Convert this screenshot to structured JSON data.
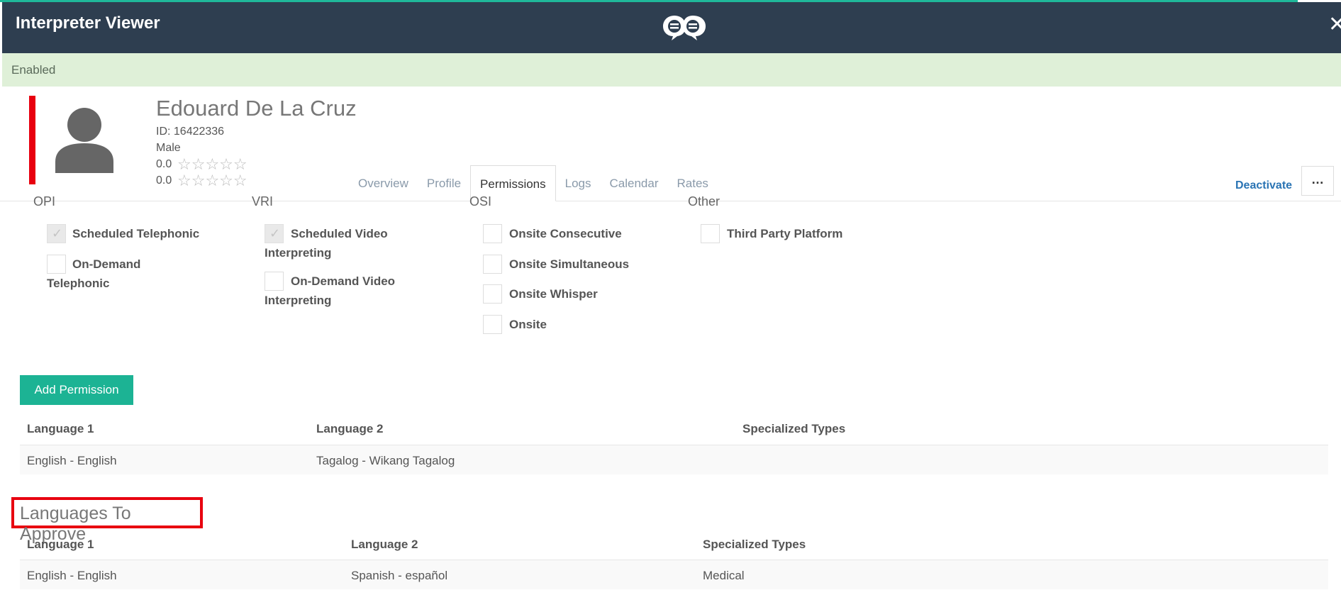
{
  "header": {
    "title": "Interpreter Viewer",
    "logo_icon": "chat-bubbles-logo",
    "close_icon": "close-icon",
    "close_glyph": "✕"
  },
  "status": {
    "label": "Enabled"
  },
  "profile": {
    "name": "Edouard De La Cruz",
    "id_label": "ID: 16422336",
    "gender": "Male",
    "rating1": "0.0",
    "rating2": "0.0",
    "stars": "☆☆☆☆☆"
  },
  "tabs": [
    {
      "label": "Overview",
      "active": false
    },
    {
      "label": "Profile",
      "active": false
    },
    {
      "label": "Permissions",
      "active": true
    },
    {
      "label": "Logs",
      "active": false
    },
    {
      "label": "Calendar",
      "active": false
    },
    {
      "label": "Rates",
      "active": false
    }
  ],
  "actions": {
    "deactivate": "Deactivate",
    "more": "…"
  },
  "categories": {
    "opi": {
      "heading": "OPI",
      "items": [
        {
          "label": "Scheduled Telephonic",
          "checked": true
        },
        {
          "label": "On-Demand Telephonic",
          "checked": false
        }
      ]
    },
    "vri": {
      "heading": "VRI",
      "items": [
        {
          "label": "Scheduled Video Interpreting",
          "checked": true
        },
        {
          "label": "On-Demand Video Interpreting",
          "checked": false
        }
      ]
    },
    "osi": {
      "heading": "OSI",
      "items": [
        {
          "label": "Onsite Consecutive",
          "checked": false
        },
        {
          "label": "Onsite Simultaneous",
          "checked": false
        },
        {
          "label": "Onsite Whisper",
          "checked": false
        },
        {
          "label": "Onsite",
          "checked": false
        }
      ]
    },
    "other": {
      "heading": "Other",
      "items": [
        {
          "label": "Third Party Platform",
          "checked": false
        }
      ]
    }
  },
  "permissions": {
    "add_button": "Add Permission",
    "columns": [
      "Language 1",
      "Language 2",
      "Specialized Types"
    ],
    "rows": [
      {
        "lang1": "English - English",
        "lang2": "Tagalog - Wikang Tagalog",
        "types": ""
      }
    ]
  },
  "approve": {
    "title": "Languages To Approve",
    "columns": [
      "Language 1",
      "Language 2",
      "Specialized Types"
    ],
    "rows": [
      {
        "lang1": "English - English",
        "lang2": "Spanish - español",
        "types": "Medical"
      }
    ]
  }
}
